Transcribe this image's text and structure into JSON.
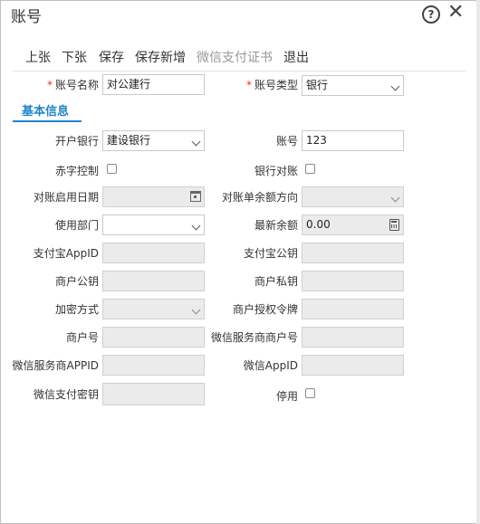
{
  "window": {
    "title": "账号"
  },
  "toolbar": {
    "items": [
      "上张",
      "下张",
      "保存",
      "保存新增",
      "微信支付证书",
      "退出"
    ]
  },
  "header_fields": {
    "account_name": {
      "label": "账号名称",
      "value": "对公建行"
    },
    "account_type": {
      "label": "账号类型",
      "value": "银行"
    }
  },
  "tab": {
    "label": "基本信息"
  },
  "fields": {
    "bank": {
      "label": "开户银行",
      "value": "建设银行"
    },
    "account_no": {
      "label": "账号",
      "value": "123"
    },
    "red_control": {
      "label": "赤字控制",
      "checked": false
    },
    "bank_reconcile": {
      "label": "银行对账",
      "checked": false
    },
    "reconcile_start_date": {
      "label": "对账启用日期",
      "value": ""
    },
    "statement_direction": {
      "label": "对账单余额方向",
      "value": ""
    },
    "department": {
      "label": "使用部门",
      "value": ""
    },
    "latest_balance": {
      "label": "最新余额",
      "value": "0.00"
    },
    "alipay_appid": {
      "label": "支付宝AppID",
      "value": ""
    },
    "alipay_public_key": {
      "label": "支付宝公钥",
      "value": ""
    },
    "merchant_public_key": {
      "label": "商户公钥",
      "value": ""
    },
    "merchant_private_key": {
      "label": "商户私钥",
      "value": ""
    },
    "encryption": {
      "label": "加密方式",
      "value": ""
    },
    "merchant_auth_token": {
      "label": "商户授权令牌",
      "value": ""
    },
    "merchant_no": {
      "label": "商户号",
      "value": ""
    },
    "wechat_sp_merchant_no": {
      "label": "微信服务商商户号",
      "value": ""
    },
    "wechat_sp_appid": {
      "label": "微信服务商APPID",
      "value": ""
    },
    "wechat_appid": {
      "label": "微信AppID",
      "value": ""
    },
    "wechat_pay_key": {
      "label": "微信支付密钥",
      "value": ""
    },
    "disabled": {
      "label": "停用",
      "checked": false
    }
  }
}
